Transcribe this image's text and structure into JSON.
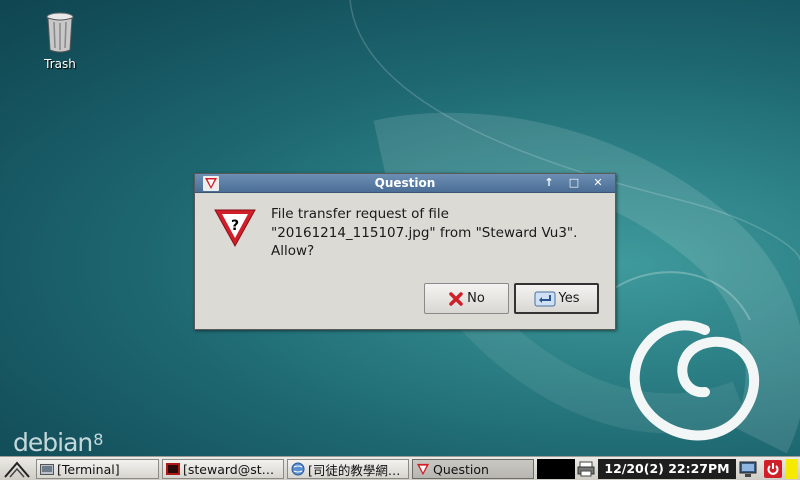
{
  "desktop": {
    "icons": [
      {
        "label": "Trash",
        "icon": "trash-icon"
      }
    ],
    "logo": {
      "text": "debian",
      "version": "8"
    }
  },
  "dialog": {
    "title": "Question",
    "message": "File transfer request of file\n\"20161214_115107.jpg\" from \"Steward Vu3\".\nAllow?",
    "buttons": {
      "no": "No",
      "yes": "Yes"
    },
    "controls": {
      "shade": "↑",
      "maximize": "□",
      "close": "✕"
    }
  },
  "taskbar": {
    "tasks": [
      {
        "label": "[Terminal]",
        "icon": "folder-icon"
      },
      {
        "label": "[steward@st…",
        "icon": "terminal-icon"
      },
      {
        "label": "[司徒的教學網…",
        "icon": "browser-icon"
      },
      {
        "label": "Question",
        "icon": "question-app-icon",
        "active": true
      }
    ],
    "clock": "12/20(2) 22:27PM"
  },
  "colors": {
    "desktop_bg": "#1d6670",
    "titlebar": "#4b6e96",
    "dialog_bg": "#dcdad5",
    "taskbar": "#dcdad5",
    "accent_red": "#d11f2a",
    "clock_bg": "#1e1e1e",
    "indicator_yellow": "#f5ea00"
  }
}
